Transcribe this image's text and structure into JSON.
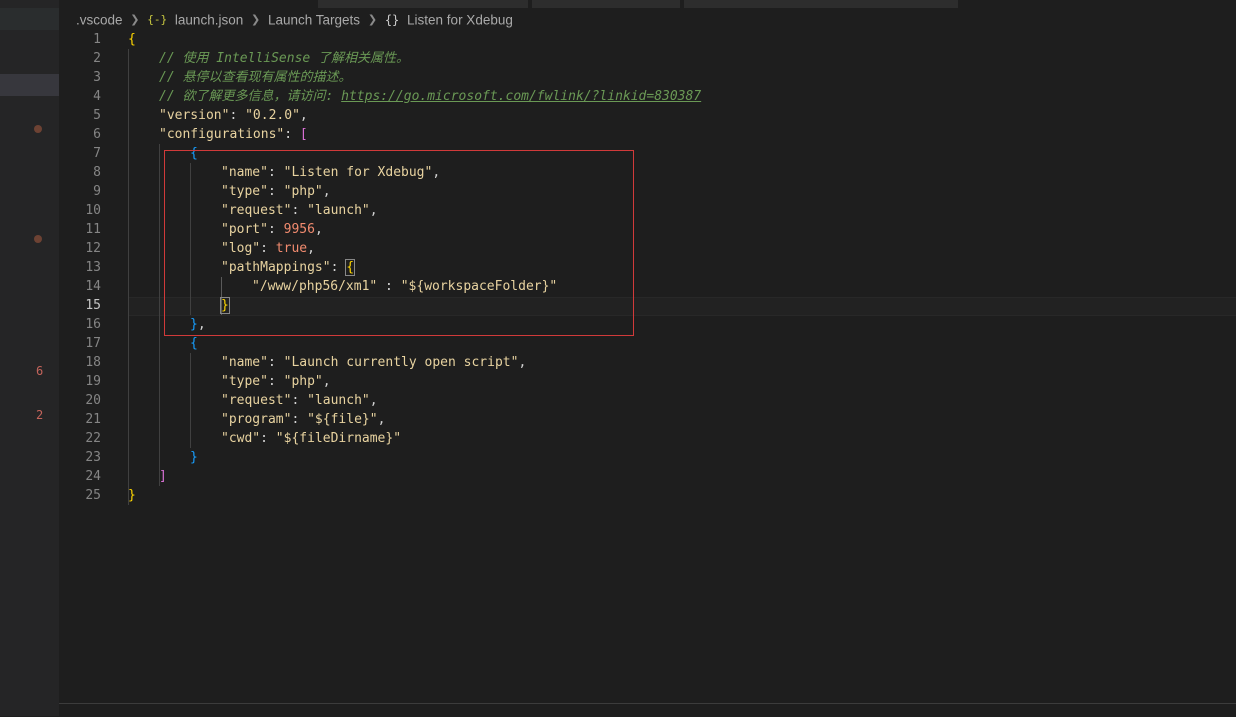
{
  "breadcrumb": {
    "folder": ".vscode",
    "file_icon": "{-}",
    "file": "launch.json",
    "section": "Launch Targets",
    "object_icon": "{}",
    "object": "Listen for Xdebug"
  },
  "left_panel": {
    "badges": [
      "6",
      "2"
    ]
  },
  "editor": {
    "active_line": 15,
    "line_numbers": [
      "1",
      "2",
      "3",
      "4",
      "5",
      "6",
      "7",
      "8",
      "9",
      "10",
      "11",
      "12",
      "13",
      "14",
      "15",
      "16",
      "17",
      "18",
      "19",
      "20",
      "21",
      "22",
      "23",
      "24",
      "25"
    ],
    "comments": [
      "// 使用 IntelliSense 了解相关属性。",
      "// 悬停以查看现有属性的描述。",
      "// 欲了解更多信息，请访问: "
    ],
    "link": "https://go.microsoft.com/fwlink/?linkid=830387",
    "version_key": "\"version\"",
    "version_value": "\"0.2.0\"",
    "configurations_key": "\"configurations\"",
    "config1": {
      "name_key": "\"name\"",
      "name_value": "\"Listen for Xdebug\"",
      "type_key": "\"type\"",
      "type_value": "\"php\"",
      "request_key": "\"request\"",
      "request_value": "\"launch\"",
      "port_key": "\"port\"",
      "port_value": "9956",
      "log_key": "\"log\"",
      "log_value": "true",
      "pathMappings_key": "\"pathMappings\"",
      "mapping_key": "\"/www/php56/xm1\"",
      "mapping_value": "\"${workspaceFolder}\""
    },
    "config2": {
      "name_key": "\"name\"",
      "name_value": "\"Launch currently open script\"",
      "type_key": "\"type\"",
      "type_value": "\"php\"",
      "request_key": "\"request\"",
      "request_value": "\"launch\"",
      "program_key": "\"program\"",
      "program_value": "\"${file}\"",
      "cwd_key": "\"cwd\"",
      "cwd_value": "\"${fileDirname}\""
    }
  },
  "colors": {
    "annotation_box": "#d13a3a",
    "background": "#1e1e1e"
  }
}
